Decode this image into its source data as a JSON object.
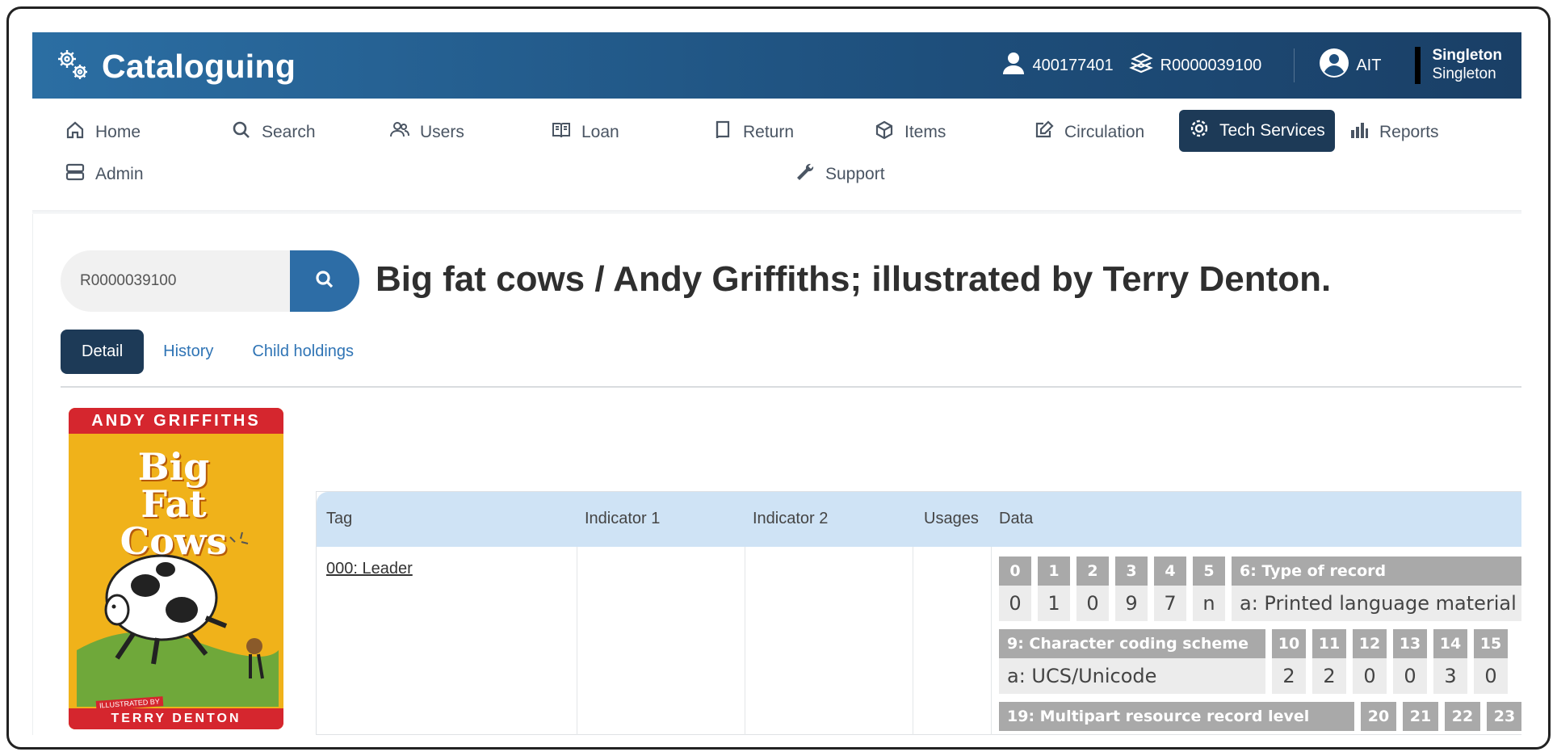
{
  "app": {
    "title": "Cataloguing"
  },
  "topbar": {
    "patron_id": "400177401",
    "record_id": "R0000039100",
    "user": "AIT",
    "location_line1": "Singleton",
    "location_line2": "Singleton"
  },
  "nav": {
    "items": [
      {
        "label": "Home",
        "icon": "home-icon"
      },
      {
        "label": "Search",
        "icon": "search-icon"
      },
      {
        "label": "Users",
        "icon": "users-icon"
      },
      {
        "label": "Loan",
        "icon": "book-open-icon"
      },
      {
        "label": "Return",
        "icon": "book-icon"
      },
      {
        "label": "Items",
        "icon": "box-icon"
      },
      {
        "label": "Circulation",
        "icon": "edit-icon"
      },
      {
        "label": "Tech Services",
        "icon": "gear-icon",
        "active": true
      },
      {
        "label": "Reports",
        "icon": "bar-chart-icon"
      },
      {
        "label": "Admin",
        "icon": "server-icon"
      },
      {
        "label": "Support",
        "icon": "wrench-icon"
      }
    ]
  },
  "search": {
    "value": "R0000039100"
  },
  "record": {
    "title": "Big fat cows / Andy Griffiths; illustrated by Terry Denton."
  },
  "tabs": [
    {
      "label": "Detail",
      "active": true
    },
    {
      "label": "History"
    },
    {
      "label": "Child holdings"
    }
  ],
  "cover": {
    "author": "ANDY GRIFFITHS",
    "title_line1": "Big Fat",
    "title_line2": "Cows",
    "illustrated_by": "ILLUSTRATED BY",
    "illustrator": "TERRY DENTON"
  },
  "marc": {
    "headers": {
      "tag": "Tag",
      "ind1": "Indicator 1",
      "ind2": "Indicator 2",
      "usages": "Usages",
      "data": "Data"
    },
    "rows": [
      {
        "tag": "000: Leader",
        "leader_row1": [
          {
            "h": "0",
            "v": "0"
          },
          {
            "h": "1",
            "v": "1"
          },
          {
            "h": "2",
            "v": "0"
          },
          {
            "h": "3",
            "v": "9"
          },
          {
            "h": "4",
            "v": "7"
          },
          {
            "h": "5",
            "v": "n"
          },
          {
            "h": "6: Type of record",
            "v": "a: Printed language material"
          }
        ],
        "leader_row2": [
          {
            "h": "9: Character coding scheme",
            "v": "a: UCS/Unicode"
          },
          {
            "h": "10",
            "v": "2"
          },
          {
            "h": "11",
            "v": "2"
          },
          {
            "h": "12",
            "v": "0"
          },
          {
            "h": "13",
            "v": "0"
          },
          {
            "h": "14",
            "v": "3"
          },
          {
            "h": "15",
            "v": "0"
          }
        ],
        "leader_row3": [
          {
            "h": "19: Multipart resource record level"
          },
          {
            "h": "20"
          },
          {
            "h": "21"
          },
          {
            "h": "22"
          },
          {
            "h": "23"
          }
        ]
      }
    ]
  }
}
